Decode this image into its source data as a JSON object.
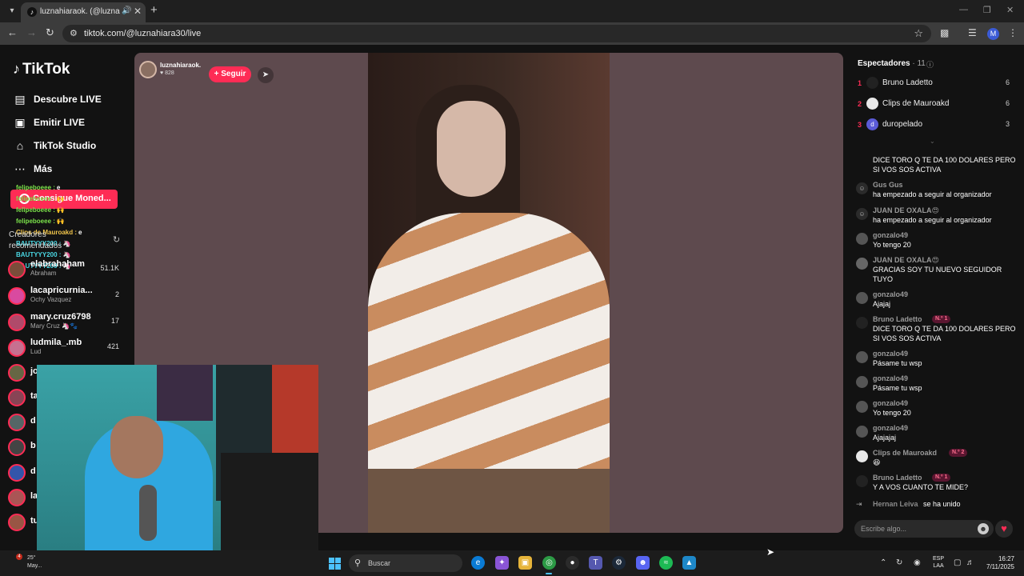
{
  "browser": {
    "tab_title": "luznahiaraok. (@luznahiara...",
    "url": "tiktok.com/@luznahiara30/live",
    "profile_initial": "M"
  },
  "sidebar": {
    "logo": "TikTok",
    "nav": [
      {
        "label": "Descubre LIVE",
        "icon": "live-discover-icon"
      },
      {
        "label": "Emitir LIVE",
        "icon": "camera-icon"
      },
      {
        "label": "TikTok Studio",
        "icon": "studio-icon"
      },
      {
        "label": "Más",
        "icon": "more-icon"
      }
    ],
    "coin_button": "Consigue Moned...",
    "overlay_chat": [
      {
        "user": "felipeboeee :",
        "text": "e",
        "color": "#7be34a"
      },
      {
        "user": "felipeboeee :",
        "text": "🙌",
        "color": "#7be34a"
      },
      {
        "user": "felipeboeee :",
        "text": "🙌",
        "color": "#7be34a"
      },
      {
        "user": "felipeboeee :",
        "text": "🙌",
        "color": "#7be34a"
      },
      {
        "user": "Clips de Mauroakd :",
        "text": "e",
        "color": "#f0c44a"
      },
      {
        "user": "BAUTYYY200 :",
        "text": "🦄",
        "color": "#4ad7e3"
      },
      {
        "user": "BAUTYYY200 :",
        "text": "🦄",
        "color": "#4ad7e3"
      },
      {
        "user": "BAUTYYY200 :",
        "text": "🦄",
        "color": "#4ad7e3"
      }
    ],
    "creators_title": "Creadores recomendados",
    "creators": [
      {
        "name": "elabrahaham",
        "sub": "Abraham",
        "count": "51.1K"
      },
      {
        "name": "lacapricurnia...",
        "sub": "Ochy Vazquez",
        "count": "2"
      },
      {
        "name": "mary.cruz6798",
        "sub": "Mary Cruz 🦄🐾",
        "count": "17"
      },
      {
        "name": "ludmila_.mb",
        "sub": "Lud",
        "count": "421"
      }
    ],
    "hidden_creators": [
      "jo",
      "ta",
      "d",
      "b",
      "d",
      "la",
      "tu"
    ]
  },
  "stream": {
    "streamer_name": "luznahiaraok.",
    "likes": "♥ 828",
    "follow_label": "+ Seguir"
  },
  "viewers": {
    "title": "Espectadores",
    "count": "· 11",
    "list": [
      {
        "rank": "1",
        "name": "Bruno Ladetto",
        "score": "6"
      },
      {
        "rank": "2",
        "name": "Clips de Mauroakd",
        "score": "6"
      },
      {
        "rank": "3",
        "name": "duropelado",
        "score": "3",
        "initial": "d"
      }
    ]
  },
  "chat": {
    "messages": [
      {
        "user": "",
        "text": "DICE TORO Q TE DA 100 DOLARES PERO SI VOS SOS ACTIVA",
        "badge": ""
      },
      {
        "user": "Gus Gus",
        "text": " ha empezado a seguir al organizador",
        "badge": ""
      },
      {
        "user": "JUAN DE OXALA😍",
        "text": " ha empezado a seguir al organizador",
        "badge": ""
      },
      {
        "user": "gonzalo49",
        "text": "Yo tengo 20",
        "badge": ""
      },
      {
        "user": "JUAN DE OXALA😍",
        "text": "GRACIAS SOY TU NUEVO SEGUIDOR TUYO",
        "badge": ""
      },
      {
        "user": "gonzalo49",
        "text": "Ajajaj",
        "badge": ""
      },
      {
        "user": "Bruno Ladetto",
        "text": "DICE TORO Q TE DA 100 DOLARES PERO SI VOS SOS ACTIVA",
        "badge": "N.º 1"
      },
      {
        "user": "gonzalo49",
        "text": "Pásame tu wsp",
        "badge": ""
      },
      {
        "user": "gonzalo49",
        "text": "Pásame tu wsp",
        "badge": ""
      },
      {
        "user": "gonzalo49",
        "text": "Yo tengo 20",
        "badge": ""
      },
      {
        "user": "gonzalo49",
        "text": "Ajajajaj",
        "badge": ""
      },
      {
        "user": "Clips de Mauroakd",
        "text": "😆",
        "badge": "N.º 2"
      },
      {
        "user": "Bruno Ladetto",
        "text": "Y A VOS CUANTO TE MIDE?",
        "badge": "N.º 1"
      }
    ],
    "join": {
      "user": "Hernan Leiva",
      "text": "se ha unido"
    },
    "input_placeholder": "Escribe algo..."
  },
  "taskbar": {
    "weather_temp": "25°",
    "weather_text": "May...",
    "weather_badge": "4",
    "search_label": "Buscar",
    "lang_top": "ESP",
    "lang_bottom": "LAA",
    "time": "16:27",
    "date": "7/11/2025"
  }
}
